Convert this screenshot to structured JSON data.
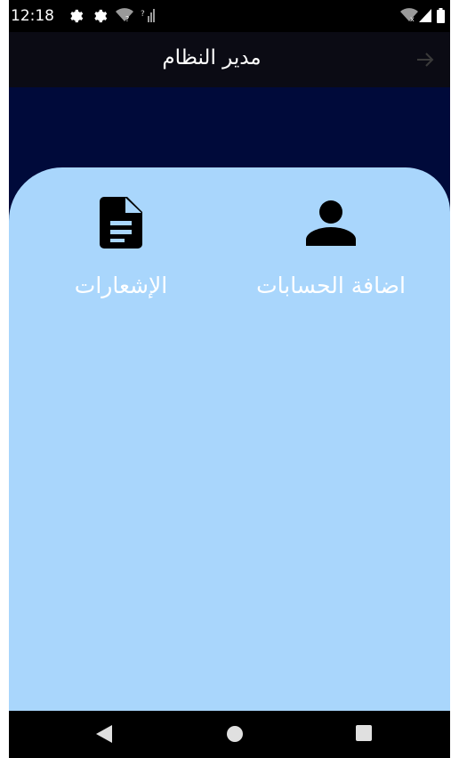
{
  "status_bar": {
    "time": "12:18",
    "left_icons": [
      "gear-icon",
      "gear-icon",
      "wifi-question-icon",
      "signal-question-icon"
    ],
    "right_icons": [
      "wifi-off-icon",
      "signal-icon",
      "battery-icon"
    ]
  },
  "app_bar": {
    "title": "مدير النظام",
    "back_icon": "arrow-right-icon"
  },
  "menu": {
    "items": [
      {
        "label": "اضافة الحسابات",
        "icon": "person-icon"
      },
      {
        "label": "الإشعارات",
        "icon": "document-icon"
      }
    ]
  },
  "nav_bar": {
    "buttons": [
      "back-triangle-icon",
      "home-circle-icon",
      "recents-square-icon"
    ]
  },
  "colors": {
    "app_bar": "#0b0b14",
    "header_band": "#000a3a",
    "card": "#a9d6fc",
    "label": "#ffffff",
    "icon": "#000000"
  }
}
